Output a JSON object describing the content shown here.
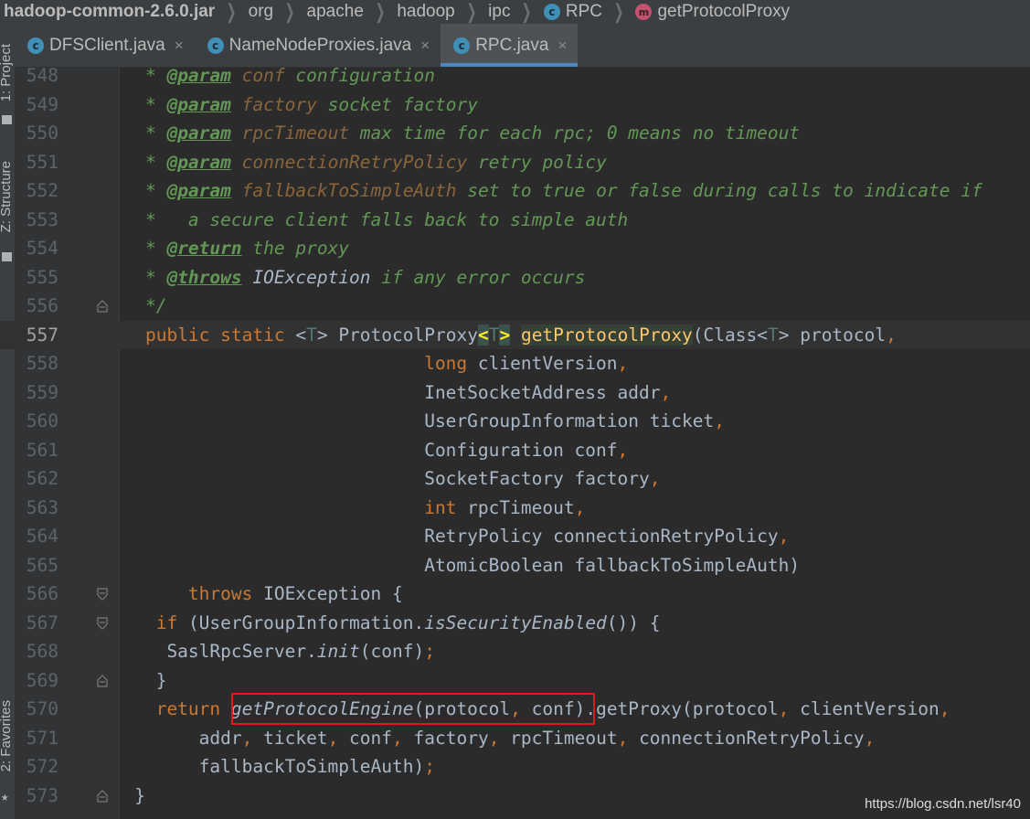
{
  "breadcrumb": {
    "items": [
      {
        "label": "hadoop-common-2.6.0.jar",
        "icon": null
      },
      {
        "label": "org",
        "icon": null
      },
      {
        "label": "apache",
        "icon": null
      },
      {
        "label": "hadoop",
        "icon": null
      },
      {
        "label": "ipc",
        "icon": null
      },
      {
        "label": "RPC",
        "icon": "class-icon",
        "glyph": "c"
      },
      {
        "label": "getProtocolProxy",
        "icon": "method-icon",
        "glyph": "m"
      }
    ]
  },
  "tool_strip": {
    "project": "1: Project",
    "structure": "Z: Structure",
    "favorites": "2: Favorites"
  },
  "tabs": [
    {
      "label": "DFSClient.java",
      "glyph": "c",
      "close": "×",
      "active": false
    },
    {
      "label": "NameNodeProxies.java",
      "glyph": "c",
      "close": "×",
      "active": false
    },
    {
      "label": "RPC.java",
      "glyph": "c",
      "close": "×",
      "active": true
    }
  ],
  "lines": [
    {
      "n": "548",
      "fold": null,
      "tokens": [
        [
          "    * ",
          "c-doc"
        ],
        [
          "@param",
          "c-tag"
        ],
        [
          " ",
          "c-doc"
        ],
        [
          "conf",
          "c-par"
        ],
        [
          " configuration",
          "c-doc"
        ]
      ]
    },
    {
      "n": "549",
      "fold": null,
      "tokens": [
        [
          "    * ",
          "c-doc"
        ],
        [
          "@param",
          "c-tag"
        ],
        [
          " ",
          "c-doc"
        ],
        [
          "factory",
          "c-par"
        ],
        [
          " socket factory",
          "c-doc"
        ]
      ]
    },
    {
      "n": "550",
      "fold": null,
      "tokens": [
        [
          "    * ",
          "c-doc"
        ],
        [
          "@param",
          "c-tag"
        ],
        [
          " ",
          "c-doc"
        ],
        [
          "rpcTimeout",
          "c-par"
        ],
        [
          " max time for each rpc; 0 means no timeout",
          "c-doc"
        ]
      ]
    },
    {
      "n": "551",
      "fold": null,
      "tokens": [
        [
          "    * ",
          "c-doc"
        ],
        [
          "@param",
          "c-tag"
        ],
        [
          " ",
          "c-doc"
        ],
        [
          "connectionRetryPolicy",
          "c-par"
        ],
        [
          " retry policy",
          "c-doc"
        ]
      ]
    },
    {
      "n": "552",
      "fold": null,
      "tokens": [
        [
          "    * ",
          "c-doc"
        ],
        [
          "@param",
          "c-tag"
        ],
        [
          " ",
          "c-doc"
        ],
        [
          "fallbackToSimpleAuth",
          "c-par"
        ],
        [
          " set to true or false during calls to indicate if",
          "c-doc"
        ]
      ]
    },
    {
      "n": "553",
      "fold": null,
      "tokens": [
        [
          "    *   a secure client falls back to simple auth",
          "c-doc"
        ]
      ]
    },
    {
      "n": "554",
      "fold": null,
      "tokens": [
        [
          "    * ",
          "c-doc"
        ],
        [
          "@return",
          "c-tag"
        ],
        [
          " the proxy",
          "c-doc"
        ]
      ]
    },
    {
      "n": "555",
      "fold": null,
      "tokens": [
        [
          "    * ",
          "c-doc"
        ],
        [
          "@throws",
          "c-tag"
        ],
        [
          " ",
          "c-doc"
        ],
        [
          "IOException",
          "c-it"
        ],
        [
          " if any error occurs",
          "c-doc"
        ]
      ]
    },
    {
      "n": "556",
      "fold": "end",
      "tokens": [
        [
          "    */",
          "c-doc"
        ]
      ]
    },
    {
      "n": "557",
      "fold": null,
      "current": true,
      "tokens": [
        [
          "    ",
          "c-txt"
        ],
        [
          "public static ",
          "c-kw"
        ],
        [
          "<",
          "c-txt"
        ],
        [
          "T",
          "c-tp"
        ],
        [
          "> ProtocolProxy",
          "c-txt"
        ],
        [
          "<",
          "c-brace"
        ],
        [
          "T",
          "c-tp"
        ],
        [
          ">",
          "c-brace"
        ],
        [
          " ",
          "c-txt"
        ],
        [
          "|caret|",
          "caret"
        ],
        [
          "getProtocolProxy",
          "c-mdecl"
        ],
        [
          "(Class<",
          "c-txt"
        ],
        [
          "T",
          "c-tp"
        ],
        [
          "> protocol",
          "c-txt"
        ],
        [
          ",",
          "c-kw"
        ]
      ]
    },
    {
      "n": "558",
      "fold": null,
      "tokens": [
        [
          "                              ",
          "c-txt"
        ],
        [
          "long ",
          "c-kw"
        ],
        [
          "clientVersion",
          "c-txt"
        ],
        [
          ",",
          "c-kw"
        ]
      ]
    },
    {
      "n": "559",
      "fold": null,
      "tokens": [
        [
          "                              InetSocketAddress addr",
          "c-txt"
        ],
        [
          ",",
          "c-kw"
        ]
      ]
    },
    {
      "n": "560",
      "fold": null,
      "tokens": [
        [
          "                              UserGroupInformation ticket",
          "c-txt"
        ],
        [
          ",",
          "c-kw"
        ]
      ]
    },
    {
      "n": "561",
      "fold": null,
      "tokens": [
        [
          "                              Configuration conf",
          "c-txt"
        ],
        [
          ",",
          "c-kw"
        ]
      ]
    },
    {
      "n": "562",
      "fold": null,
      "tokens": [
        [
          "                              SocketFactory factory",
          "c-txt"
        ],
        [
          ",",
          "c-kw"
        ]
      ]
    },
    {
      "n": "563",
      "fold": null,
      "tokens": [
        [
          "                              ",
          "c-txt"
        ],
        [
          "int ",
          "c-kw"
        ],
        [
          "rpcTimeout",
          "c-txt"
        ],
        [
          ",",
          "c-kw"
        ]
      ]
    },
    {
      "n": "564",
      "fold": null,
      "tokens": [
        [
          "                              RetryPolicy connectionRetryPolicy",
          "c-txt"
        ],
        [
          ",",
          "c-kw"
        ]
      ]
    },
    {
      "n": "565",
      "fold": null,
      "tokens": [
        [
          "                              AtomicBoolean fallbackToSimpleAuth)",
          "c-txt"
        ]
      ]
    },
    {
      "n": "566",
      "fold": "start",
      "tokens": [
        [
          "        ",
          "c-txt"
        ],
        [
          "throws ",
          "c-kw"
        ],
        [
          "IOException {",
          "c-txt"
        ]
      ]
    },
    {
      "n": "567",
      "fold": "start",
      "tokens": [
        [
          "     ",
          "c-txt"
        ],
        [
          "if ",
          "c-kw"
        ],
        [
          "(UserGroupInformation.",
          "c-txt"
        ],
        [
          "isSecurityEnabled",
          "c-it"
        ],
        [
          "()) {",
          "c-txt"
        ]
      ]
    },
    {
      "n": "568",
      "fold": null,
      "tokens": [
        [
          "      SaslRpcServer.",
          "c-txt"
        ],
        [
          "init",
          "c-it"
        ],
        [
          "(conf)",
          "c-txt"
        ],
        [
          ";",
          "c-kw"
        ]
      ]
    },
    {
      "n": "569",
      "fold": "end",
      "tokens": [
        [
          "     }",
          "c-txt"
        ]
      ]
    },
    {
      "n": "570",
      "fold": null,
      "tokens": [
        [
          "     ",
          "c-txt"
        ],
        [
          "return ",
          "c-kw"
        ],
        [
          "getProtocolEngine",
          "c-it"
        ],
        [
          "(protocol",
          "c-txt"
        ],
        [
          ", ",
          "c-kw"
        ],
        [
          "conf).getProxy(protocol",
          "c-txt"
        ],
        [
          ", ",
          "c-kw"
        ],
        [
          "clientVersion",
          "c-txt"
        ],
        [
          ",",
          "c-kw"
        ]
      ]
    },
    {
      "n": "571",
      "fold": null,
      "tokens": [
        [
          "         addr",
          "c-txt"
        ],
        [
          ", ",
          "c-kw"
        ],
        [
          "ticket",
          "c-txt"
        ],
        [
          ", ",
          "c-kw"
        ],
        [
          "conf",
          "c-txt"
        ],
        [
          ", ",
          "c-kw"
        ],
        [
          "factory",
          "c-txt"
        ],
        [
          ", ",
          "c-kw"
        ],
        [
          "rpcTimeout",
          "c-txt"
        ],
        [
          ", ",
          "c-kw"
        ],
        [
          "connectionRetryPolicy",
          "c-txt"
        ],
        [
          ",",
          "c-kw"
        ]
      ]
    },
    {
      "n": "572",
      "fold": null,
      "tokens": [
        [
          "         fallbackToSimpleAuth)",
          "c-txt"
        ],
        [
          ";",
          "c-kw"
        ]
      ]
    },
    {
      "n": "573",
      "fold": "end",
      "tokens": [
        [
          "   }",
          "c-txt"
        ]
      ]
    }
  ],
  "watermark": "https://blog.csdn.net/lsr40"
}
